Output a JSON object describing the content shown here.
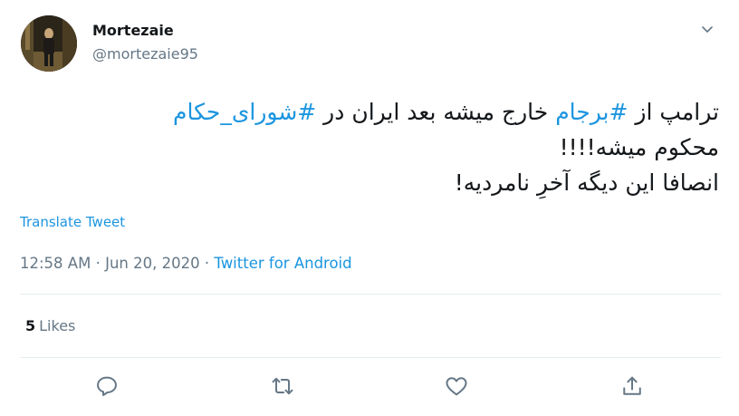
{
  "user": {
    "display_name": "Mortezaie",
    "handle": "@mortezaie95"
  },
  "tweet": {
    "part1": "ترامپ از ",
    "hashtag1": "#برجام",
    "part2": " خارج میشه بعد ایران در ",
    "hashtag2": "#شورای_حکام",
    "part3": "\nمحکوم میشه!!!!\nانصافا این دیگه آخرِ نامردیه!"
  },
  "translate_label": "Translate Tweet",
  "meta": {
    "time": "12:58 AM",
    "separator1": " · ",
    "date": "Jun 20, 2020",
    "separator2": " · ",
    "source": "Twitter for Android"
  },
  "likes": {
    "count": "5",
    "label": "Likes"
  },
  "colors": {
    "link": "#1b95e0",
    "text": "#14171a",
    "secondary": "#657786",
    "divider": "#e6ecf0"
  },
  "icons": [
    "caret-down-icon",
    "reply-icon",
    "retweet-icon",
    "like-icon",
    "share-icon"
  ]
}
